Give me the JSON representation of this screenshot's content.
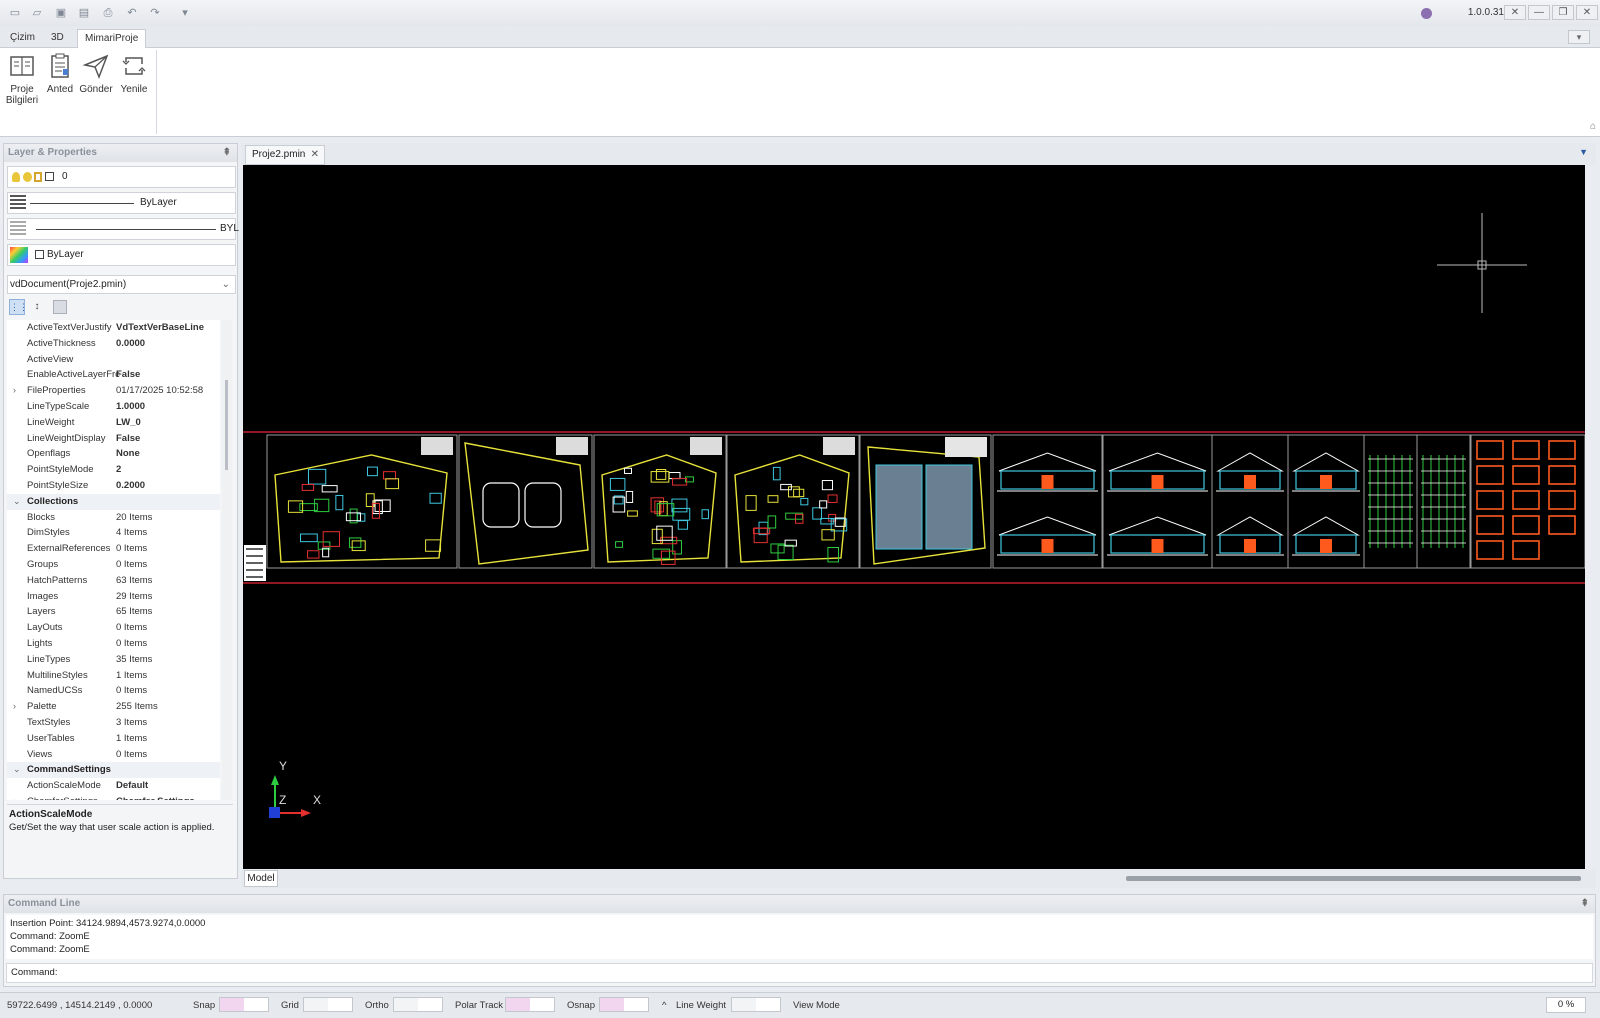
{
  "app": {
    "version": "1.0.0.31",
    "quick_access_icons": [
      "new-icon",
      "open-icon",
      "save-icon",
      "save-as-icon",
      "print-icon",
      "undo-icon",
      "redo-icon",
      "customize-icon"
    ]
  },
  "ribbon": {
    "tabs": [
      "Çizim",
      "3D",
      "MimariProje"
    ],
    "active_tab": "MimariProje",
    "buttons": [
      {
        "label": "Proje\nBilgileri",
        "icon": "project-info-icon"
      },
      {
        "label": "Anted",
        "icon": "anted-icon"
      },
      {
        "label": "Gönder",
        "icon": "send-icon"
      },
      {
        "label": "Yenile",
        "icon": "refresh-icon"
      }
    ]
  },
  "left_panel": {
    "title": "Layer & Properties",
    "layer_value": "0",
    "linetype_value": "ByLayer",
    "lineweight_value": "BYL",
    "color_value": "ByLayer",
    "document_selector": "vdDocument(Proje2.pmin)",
    "properties": [
      {
        "name": "ActiveTextVerJustify",
        "value": "VdTextVerBaseLine",
        "bold": true
      },
      {
        "name": "ActiveThickness",
        "value": "0.0000",
        "bold": true
      },
      {
        "name": "ActiveView",
        "value": ""
      },
      {
        "name": "EnableActiveLayerFrc",
        "value": "False",
        "bold": true
      },
      {
        "name": "FileProperties",
        "value": "01/17/2025 10:52:58",
        "expand": ">"
      },
      {
        "name": "LineTypeScale",
        "value": "1.0000",
        "bold": true
      },
      {
        "name": "LineWeight",
        "value": "LW_0",
        "bold": true
      },
      {
        "name": "LineWeightDisplay",
        "value": "False",
        "bold": true
      },
      {
        "name": "Openflags",
        "value": "None",
        "bold": true
      },
      {
        "name": "PointStyleMode",
        "value": "2",
        "bold": true
      },
      {
        "name": "PointStyleSize",
        "value": "0.2000",
        "bold": true
      },
      {
        "name": "Collections",
        "value": "",
        "category": true,
        "expand": "v"
      },
      {
        "name": "Blocks",
        "value": "20 Items"
      },
      {
        "name": "DimStyles",
        "value": "4 Items"
      },
      {
        "name": "ExternalReferences",
        "value": "0 Items"
      },
      {
        "name": "Groups",
        "value": "0 Items"
      },
      {
        "name": "HatchPatterns",
        "value": "63 Items"
      },
      {
        "name": "Images",
        "value": "29 Items"
      },
      {
        "name": "Layers",
        "value": "65 Items"
      },
      {
        "name": "LayOuts",
        "value": "0 Items"
      },
      {
        "name": "Lights",
        "value": "0 Items"
      },
      {
        "name": "LineTypes",
        "value": "35 Items"
      },
      {
        "name": "MultilineStyles",
        "value": "1 Items"
      },
      {
        "name": "NamedUCSs",
        "value": "0 Items"
      },
      {
        "name": "Palette",
        "value": "255 Items",
        "expand": ">"
      },
      {
        "name": "TextStyles",
        "value": "3 Items"
      },
      {
        "name": "UserTables",
        "value": "1 Items"
      },
      {
        "name": "Views",
        "value": "0 Items"
      },
      {
        "name": "CommandSettings",
        "value": "",
        "category": true,
        "expand": "v"
      },
      {
        "name": "ActionScaleMode",
        "value": "Default",
        "bold": true
      },
      {
        "name": "ChamferSettings",
        "value": "Chamfer Settings",
        "bold": true,
        "expand": ">"
      }
    ],
    "description_title": "ActionScaleMode",
    "description_text": "Get/Set the way that user scale action is applied."
  },
  "document": {
    "tab_name": "Proje2.pmin",
    "layout_tab": "Model",
    "ucs": {
      "y": "Y",
      "x": "X",
      "z": "Z"
    }
  },
  "command_line": {
    "title": "Command Line",
    "history": [
      "Insertion Point: 34124.9894,4573.9274,0.0000",
      "Command: ZoomE",
      "Command: ZoomE"
    ],
    "prompt": "Command:"
  },
  "status_bar": {
    "coordinates": "59722.6499 , 14514.2149 , 0.0000",
    "toggles": [
      "Snap",
      "Grid",
      "Ortho",
      "Polar Track",
      "Osnap"
    ],
    "line_weight_label": "Line Weight",
    "view_mode_label": "View Mode",
    "caret": "^",
    "zoom": "0 %"
  },
  "colors": {
    "drawing_bg": "#000000",
    "frame_red": "#c0202a",
    "cad_yellow": "#e7e23a",
    "cad_cyan": "#3fc7e0",
    "cad_orange": "#ff5a1e",
    "toggle_pink": "#f2d6ef"
  }
}
